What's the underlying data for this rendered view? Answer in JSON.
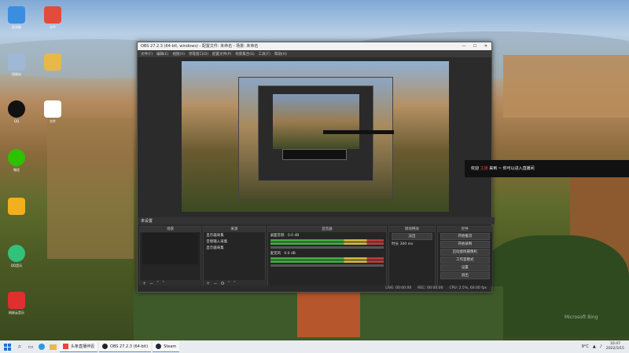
{
  "desktop": {
    "icons": [
      {
        "label": "此电脑",
        "icon": "computer-icon",
        "color": "#3b8de0"
      },
      {
        "label": "回收站",
        "icon": "recycle-bin-icon",
        "color": "#9fb8d6"
      },
      {
        "label": "QQ",
        "icon": "qq-penguin-icon",
        "color": "#111111"
      },
      {
        "label": "微信",
        "icon": "wechat-icon",
        "color": "#2dc100"
      },
      {
        "label": "",
        "icon": "music-app-icon",
        "color": "#f2b01e"
      },
      {
        "label": "QQ音乐",
        "icon": "qq-music-icon",
        "color": "#31c27c"
      },
      {
        "label": "网易云音乐",
        "icon": "netease-music-icon",
        "color": "#e02f2f"
      }
    ],
    "icons_col2": [
      {
        "label": "文件",
        "icon": "pdf-file-icon",
        "color": "#e24c3b"
      },
      {
        "label": "",
        "icon": "folder-icon",
        "color": "#e8b84a"
      },
      {
        "label": "文件",
        "icon": "blank-file-icon",
        "color": "#ffffff"
      }
    ]
  },
  "obs": {
    "title": "OBS 27.2.3 (64-bit, windows) - 配置文件: 未命名 - 场景: 未命名",
    "menu": [
      "文件(F)",
      "编辑(E)",
      "视图(V)",
      "停靠窗口(D)",
      "配置文件(P)",
      "场景集合(S)",
      "工具(T)",
      "帮助(H)"
    ],
    "scene_label": "未设置",
    "sections": {
      "scenes": "场景",
      "sources": "来源",
      "mixer": "混音器",
      "transitions": "转场特效",
      "controls": "控件"
    },
    "sources": [
      "显示器采集",
      "音频输入采集",
      "显示器采集"
    ],
    "mixer": [
      {
        "name": "桌面音频",
        "level": "0.0 dB"
      },
      {
        "name": "麦克风",
        "level": "0.0 dB"
      }
    ],
    "transition": {
      "type": "淡出",
      "duration_label": "时长",
      "duration": "300 ms"
    },
    "controls": [
      "开始推流",
      "开始录制",
      "启动虚拟摄像机",
      "工作室模式",
      "设置",
      "退出"
    ],
    "status": {
      "live": "LIVE: 00:00:00",
      "rec": "REC: 00:00:00",
      "cpu": "CPU: 2.5%, 60.00 fps"
    },
    "window_buttons": [
      "—",
      "☐",
      "✕"
    ]
  },
  "chat": {
    "prefix": "欢迎 ",
    "highlight": "主播",
    "suffix": " 来到 ~ 你可以进入直播间"
  },
  "taskbar": {
    "apps": [
      {
        "label": "头条直播伴侣",
        "icon": "app-icon",
        "color": "#e04a3c"
      },
      {
        "label": "OBS 27.2.3 (64-bit)",
        "icon": "obs-icon",
        "color": "#222222"
      },
      {
        "label": "Steam",
        "icon": "steam-icon",
        "color": "#1b2838"
      }
    ],
    "weather": "9°C",
    "time": "10:47",
    "date": "2022/3/15"
  },
  "watermark": "Microsoft Bing"
}
